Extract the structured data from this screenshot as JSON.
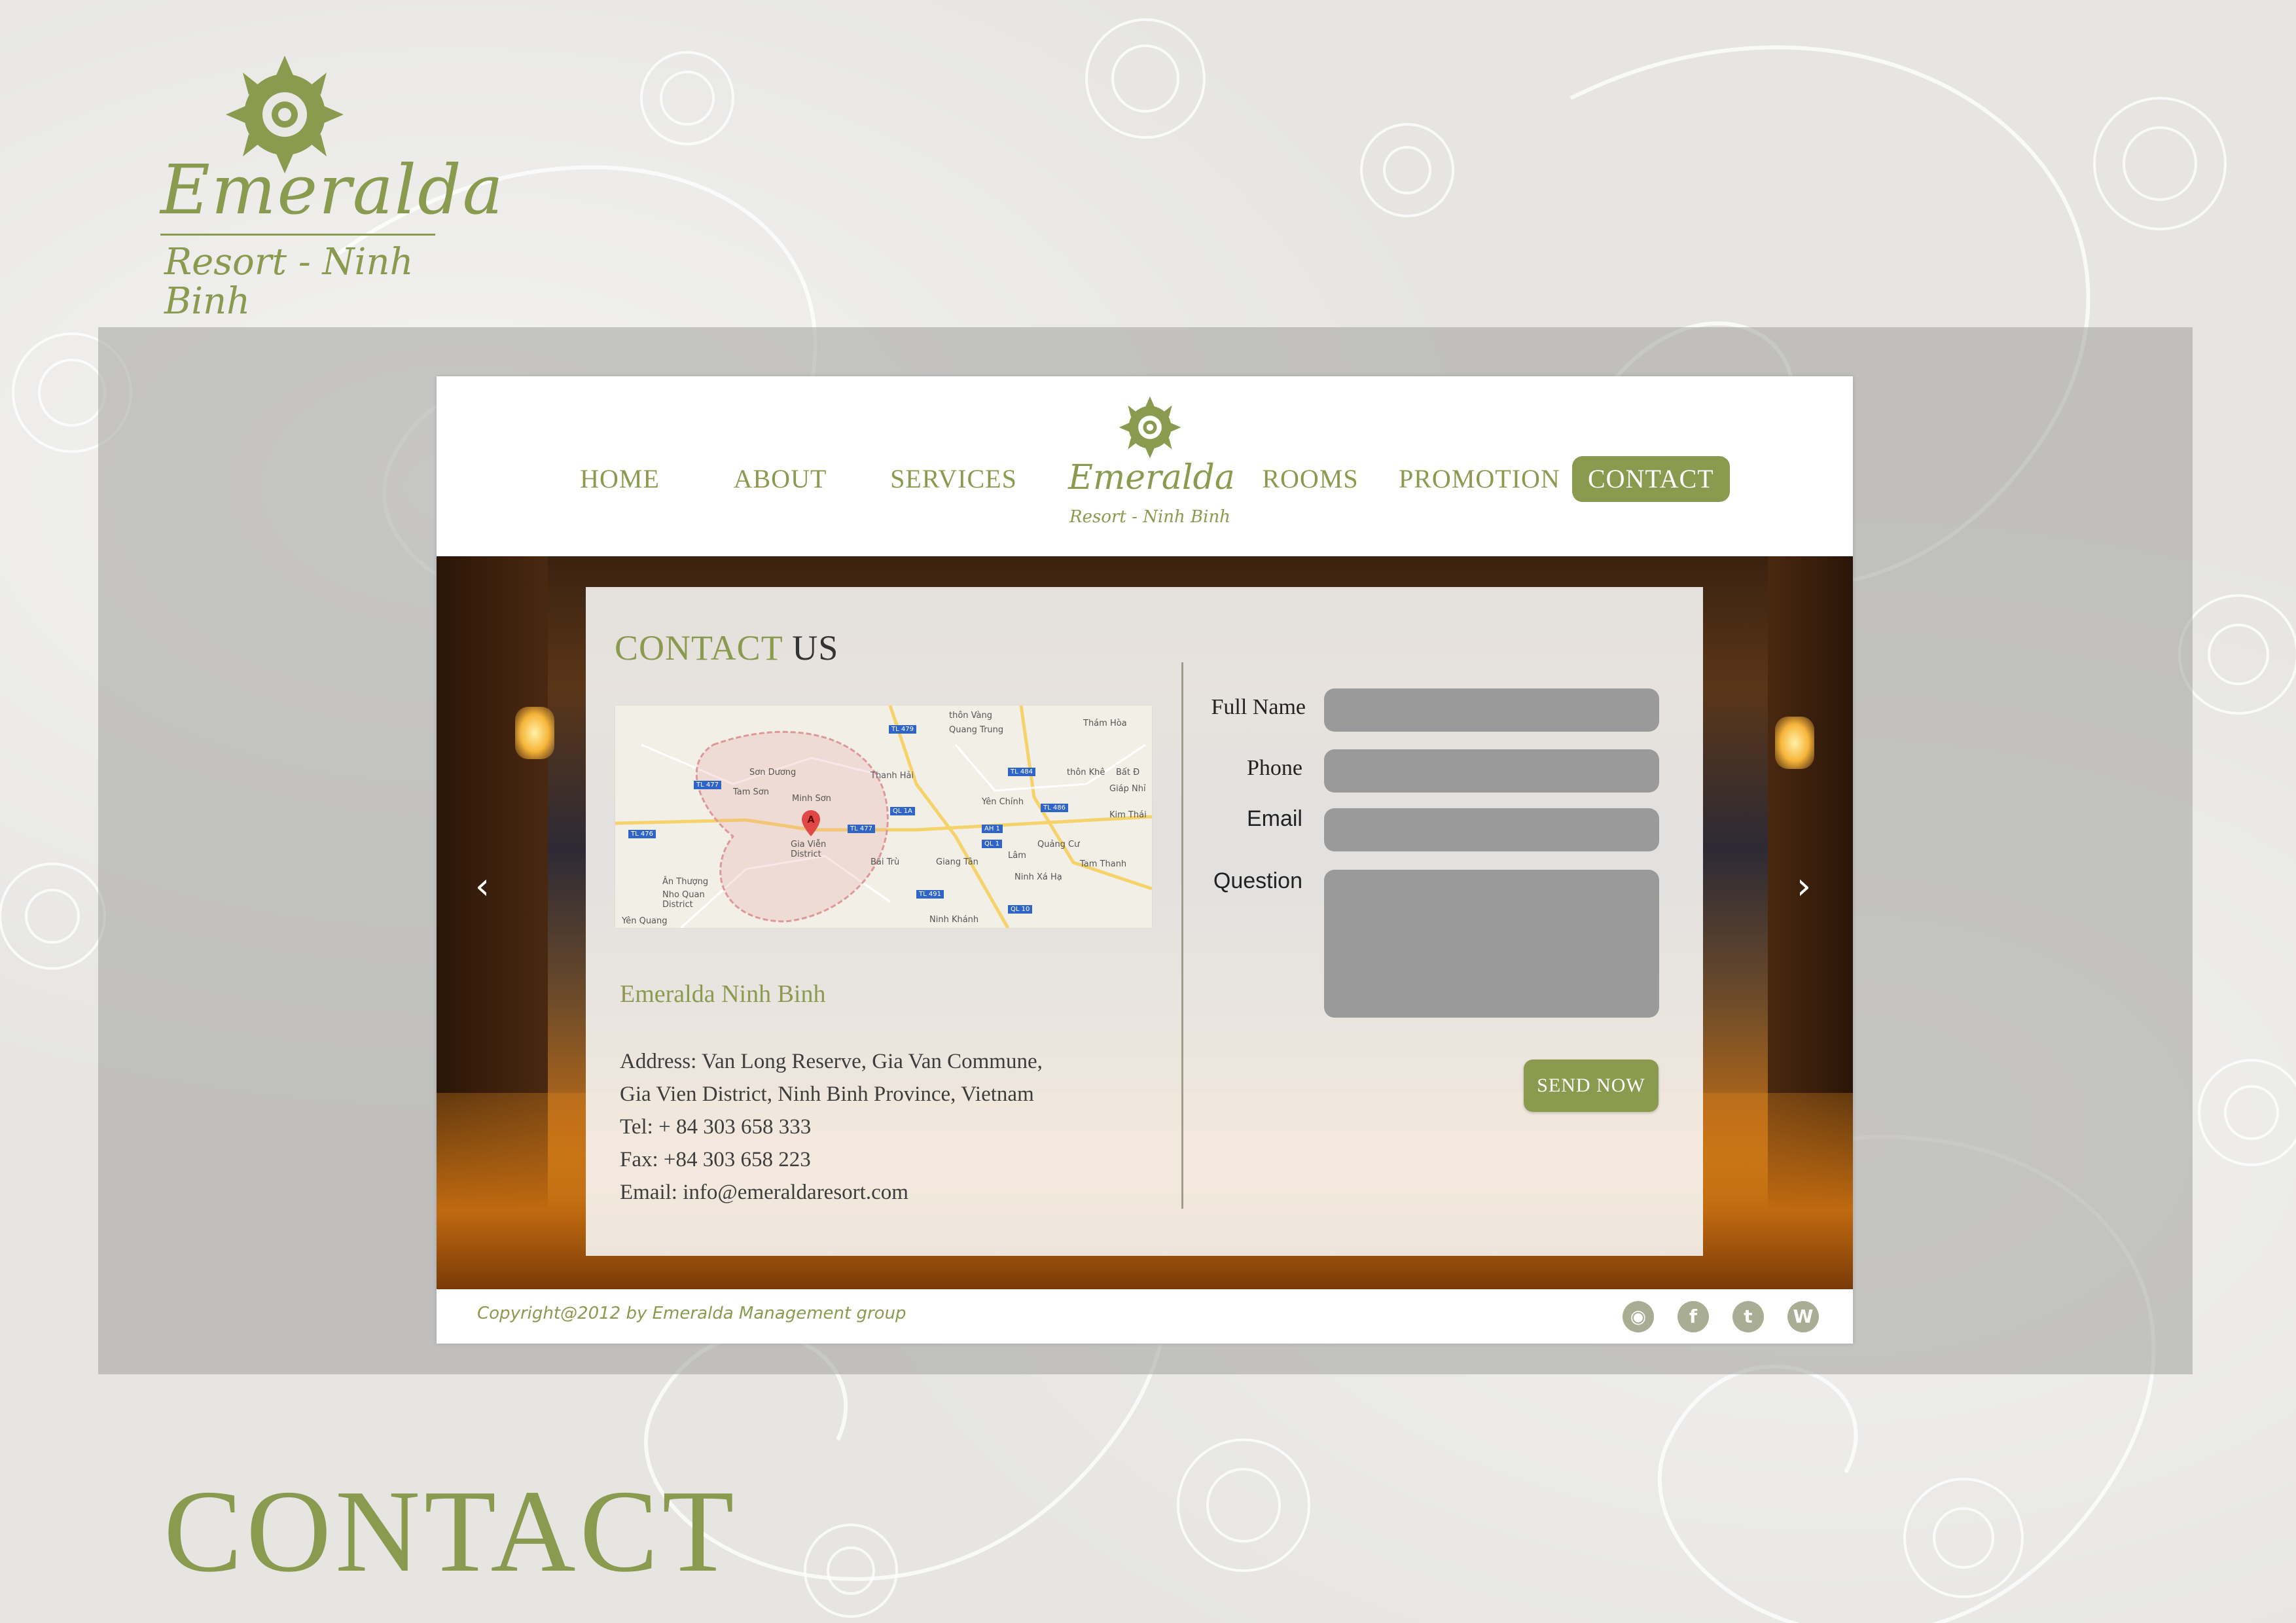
{
  "brand": {
    "name": "Emeralda",
    "tagline": "Resort - Ninh Binh",
    "color": "#8a9a4f"
  },
  "nav": {
    "items": [
      {
        "label": "HOME"
      },
      {
        "label": "ABOUT"
      },
      {
        "label": "SERVICES"
      },
      {
        "label": "ROOMS"
      },
      {
        "label": "PROMOTION"
      },
      {
        "label": "CONTACT",
        "active": true
      }
    ],
    "logo_name": "Emeralda",
    "logo_tagline": "Resort - Ninh Binh"
  },
  "hero": {
    "prev_icon": "chevron-left-icon",
    "next_icon": "chevron-right-icon"
  },
  "contact": {
    "title_part1": "CONTACT",
    "title_part2": "US",
    "map": {
      "labels": [
        "thôn Vàng",
        "Quang Trung",
        "Thám Hòa",
        "Sơn Dương",
        "Thanh Hải",
        "Tam Sơn",
        "Minh Sơn",
        "Gia Viễn District",
        "Yên Chính",
        "thôn Khê",
        "Bất Đ",
        "Giáp Nhỉ",
        "Kim Thái",
        "Ân Thượng",
        "Nho Quan District",
        "Bãi Trù",
        "Giang Tân",
        "Lâm",
        "Quảng Cư",
        "Tam Thanh",
        "Ninh Xá Hạ",
        "Ninh Khánh",
        "Yên Quang"
      ],
      "roads": [
        "TL 479",
        "TL 477",
        "TL 476",
        "TL 491",
        "TL 477",
        "TL 484",
        "TL 486",
        "QL 1A",
        "QL 10",
        "AH 1",
        "QL 1"
      ]
    },
    "hotel_name": "Emeralda Ninh Binh",
    "address_line1": "Address: Van Long Reserve, Gia Van Commune,",
    "address_line2": "Gia Vien District, Ninh Binh Province, Vietnam",
    "tel": "Tel: + 84 303 658 333",
    "fax": "Fax: +84 303 658 223",
    "email": "Email: info@emeraldaresort.com"
  },
  "form": {
    "full_name_label": "Full Name",
    "phone_label": "Phone",
    "email_label": "Email",
    "question_label": "Question",
    "full_name_value": "",
    "phone_value": "",
    "email_value": "",
    "question_value": "",
    "send_label": "SEND NOW"
  },
  "footer": {
    "copyright": "Copyright@2012 by Emeralda Management group",
    "social": [
      {
        "icon": "rss-icon",
        "glyph": "◉"
      },
      {
        "icon": "facebook-icon",
        "glyph": "f"
      },
      {
        "icon": "twitter-icon",
        "glyph": "t"
      },
      {
        "icon": "wordpress-icon",
        "glyph": "W"
      }
    ]
  },
  "page": {
    "section_title": "CONTACT"
  }
}
